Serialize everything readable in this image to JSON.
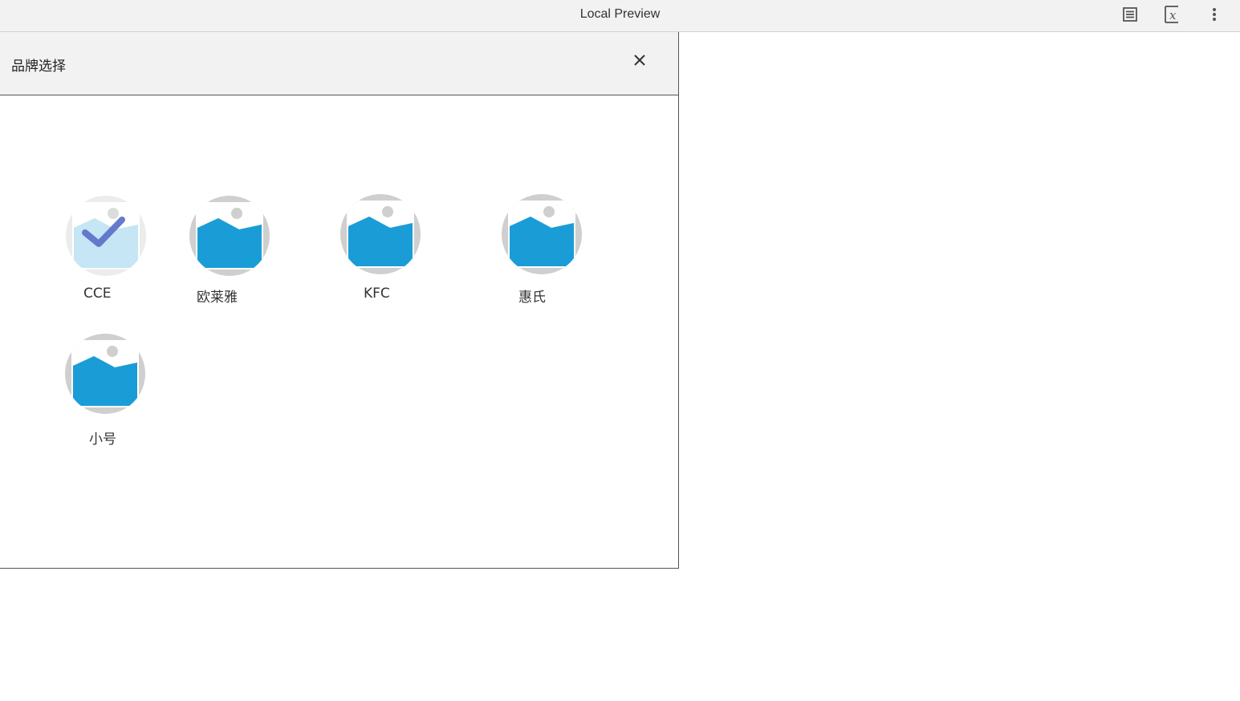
{
  "window": {
    "title": "Local Preview",
    "icons": [
      "document-icon",
      "variable-icon",
      "more-vert-icon"
    ]
  },
  "dialog": {
    "title": "品牌选择",
    "close_icon": "close-icon"
  },
  "brands": [
    {
      "label": "CCE",
      "selected": true
    },
    {
      "label": "欧莱雅",
      "selected": false
    },
    {
      "label": "KFC",
      "selected": false
    },
    {
      "label": "惠氏",
      "selected": false
    },
    {
      "label": "小号",
      "selected": false
    }
  ],
  "colors": {
    "image_blue": "#1a9dd6",
    "image_blue_selected": "#c6e5f5",
    "check_purple": "#5e73c9",
    "placeholder_gray": "#cfcfcf"
  }
}
